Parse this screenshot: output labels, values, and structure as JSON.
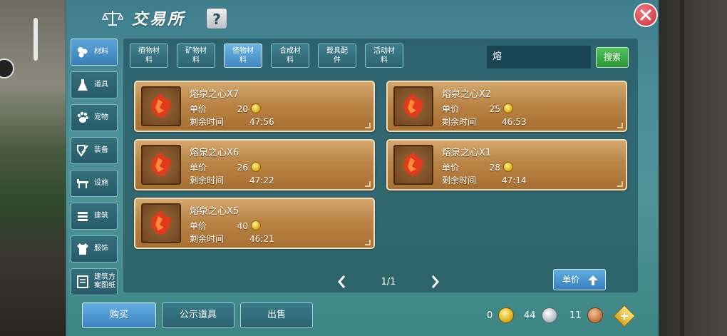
{
  "window": {
    "title": "交易所",
    "help_label": "?"
  },
  "categories": [
    {
      "label": "材料",
      "icon": "materials-icon",
      "active": true
    },
    {
      "label": "道具",
      "icon": "potion-icon",
      "active": false
    },
    {
      "label": "宠物",
      "icon": "paw-icon",
      "active": false
    },
    {
      "label": "装备",
      "icon": "equipment-icon",
      "active": false
    },
    {
      "label": "设施",
      "icon": "facility-icon",
      "active": false
    },
    {
      "label": "建筑",
      "icon": "building-icon",
      "active": false
    },
    {
      "label": "服饰",
      "icon": "clothing-icon",
      "active": false
    },
    {
      "label": "建筑方案图纸",
      "icon": "blueprint-icon",
      "active": false
    }
  ],
  "tabs": [
    {
      "label": "植物材料",
      "active": false
    },
    {
      "label": "矿物材料",
      "active": false
    },
    {
      "label": "怪物材料",
      "active": true
    },
    {
      "label": "合成材料",
      "active": false
    },
    {
      "label": "载具配件",
      "active": false
    },
    {
      "label": "活动材料",
      "active": false
    }
  ],
  "search": {
    "value": "熔",
    "button_label": "搜索"
  },
  "field_labels": {
    "unit_price": "单价",
    "remaining_time": "剩余时间"
  },
  "listings": [
    {
      "name": "熔泉之心X7",
      "price": "20",
      "time": "47:56"
    },
    {
      "name": "熔泉之心X2",
      "price": "25",
      "time": "46:53"
    },
    {
      "name": "熔泉之心X6",
      "price": "26",
      "time": "47:22"
    },
    {
      "name": "熔泉之心X1",
      "price": "28",
      "time": "47:14"
    },
    {
      "name": "熔泉之心X5",
      "price": "40",
      "time": "46:21"
    }
  ],
  "pagination": {
    "page": "1/1"
  },
  "sort": {
    "label": "单价"
  },
  "bottom_buttons": {
    "buy": "购买",
    "showcase": "公示道具",
    "sell": "出售"
  },
  "currency": {
    "gold": "0",
    "silver": "44",
    "copper": "11"
  },
  "colors": {
    "panel": "#4b8e99",
    "active_button": "#4a8fc9",
    "card": "#b98547",
    "search_button": "#3fae48",
    "close_button": "#d94452"
  }
}
